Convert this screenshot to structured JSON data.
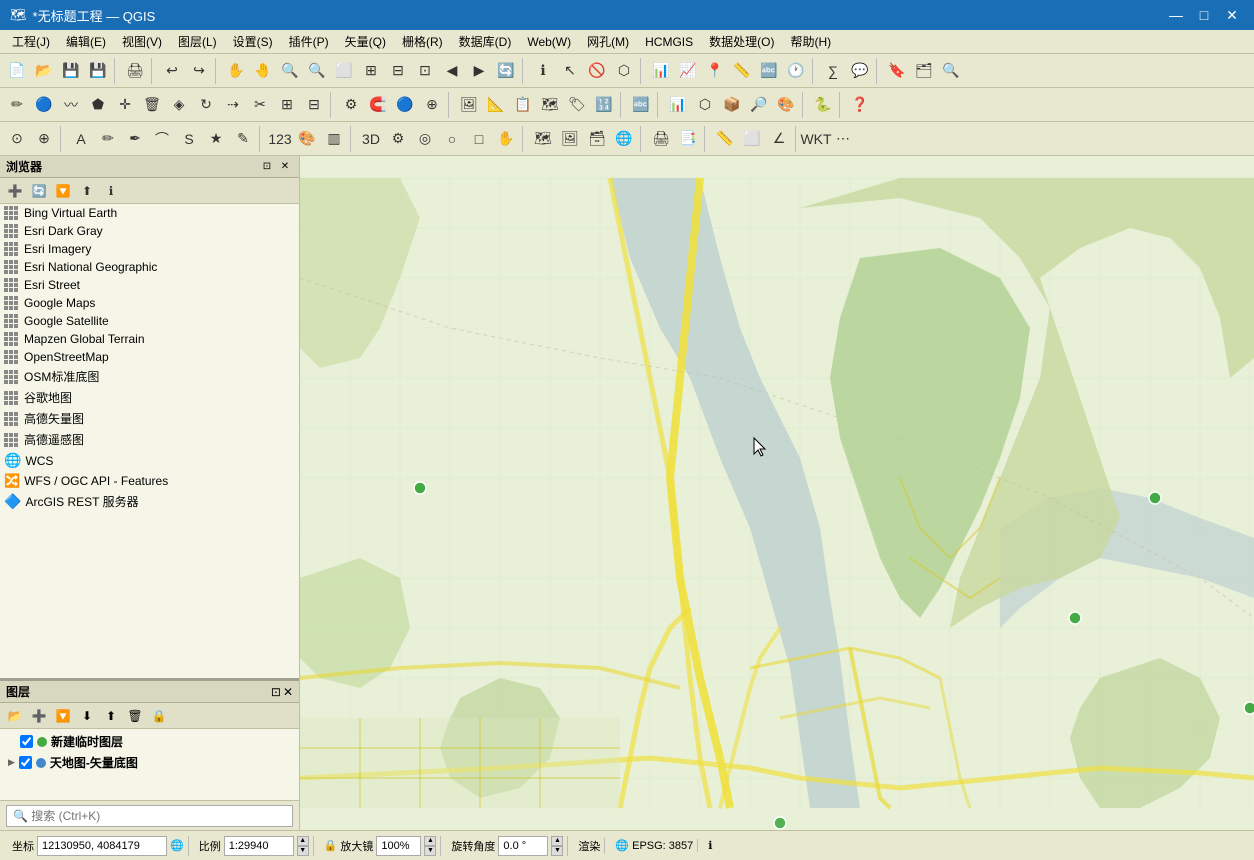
{
  "titlebar": {
    "title": "*无标题工程 — QGIS",
    "icon": "🗺",
    "minimize": "—",
    "maximize": "□",
    "close": "✕"
  },
  "menubar": {
    "items": [
      "工程(J)",
      "编辑(E)",
      "视图(V)",
      "图层(L)",
      "设置(S)",
      "插件(P)",
      "矢量(Q)",
      "栅格(R)",
      "数据库(D)",
      "Web(W)",
      "网孔(M)",
      "HCMGIS",
      "数据处理(O)",
      "帮助(H)"
    ]
  },
  "panels": {
    "browser": {
      "title": "浏览器",
      "items": [
        {
          "label": "Bing Virtual Earth",
          "type": "grid"
        },
        {
          "label": "Esri Dark Gray",
          "type": "grid"
        },
        {
          "label": "Esri Imagery",
          "type": "grid"
        },
        {
          "label": "Esri National Geographic",
          "type": "grid"
        },
        {
          "label": "Esri Street",
          "type": "grid"
        },
        {
          "label": "Google Maps",
          "type": "grid"
        },
        {
          "label": "Google Satellite",
          "type": "grid"
        },
        {
          "label": "Mapzen Global Terrain",
          "type": "grid"
        },
        {
          "label": "OpenStreetMap",
          "type": "grid"
        },
        {
          "label": "OSM标准底图",
          "type": "grid"
        },
        {
          "label": "谷歌地图",
          "type": "grid"
        },
        {
          "label": "高德矢量图",
          "type": "grid"
        },
        {
          "label": "高德遥感图",
          "type": "grid"
        },
        {
          "label": "WCS",
          "type": "globe"
        },
        {
          "label": "WFS / OGC API - Features",
          "type": "wfs"
        },
        {
          "label": "ArcGIS REST 服务器",
          "type": "arcgis"
        }
      ]
    },
    "layers": {
      "title": "图层",
      "items": [
        {
          "label": "新建临时图层",
          "checked": true,
          "color": "green",
          "bold": true
        },
        {
          "label": "天地图-矢量底图",
          "checked": true,
          "color": "blue",
          "bold": true
        }
      ]
    }
  },
  "searchbar": {
    "placeholder": "🔍 搜索 (Ctrl+K)"
  },
  "statusbar": {
    "coords_label": "坐标",
    "coords_value": "12130950, 4084179",
    "scale_label": "比例",
    "scale_value": "1:29940",
    "lock_icon": "🔒",
    "zoom_label": "放大镜",
    "zoom_value": "100%",
    "rotate_label": "旋转角度",
    "rotate_value": "0.0 °",
    "render_label": "渲染",
    "crs_label": "EPSG: 3857",
    "info_icon": "ℹ"
  }
}
